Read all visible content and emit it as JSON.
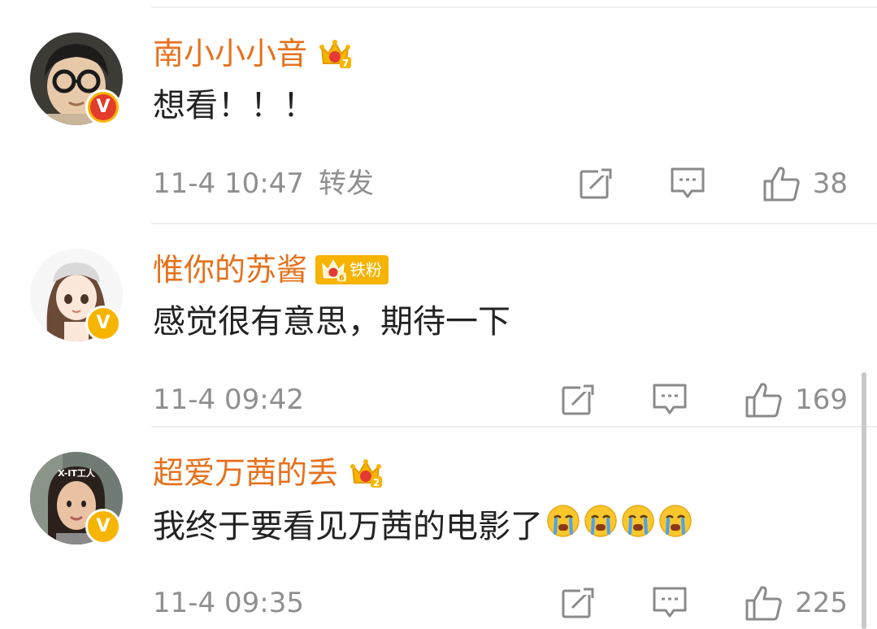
{
  "comments": [
    {
      "username": "南小小小音",
      "crown_level": "7",
      "fan_badge": "",
      "verified_color": "red",
      "verified_glyph": "V",
      "text": "想看！！！",
      "emoji_count": 0,
      "timestamp": "11-4 10:47",
      "repost_label": "转发",
      "likes": "38",
      "avatar_desc": "child-with-round-glasses"
    },
    {
      "username": "惟你的苏酱",
      "crown_level": "6",
      "fan_badge": "铁粉",
      "verified_color": "gold",
      "verified_glyph": "V",
      "text": "感觉很有意思，期待一下",
      "emoji_count": 0,
      "timestamp": "11-4 09:42",
      "repost_label": "",
      "likes": "169",
      "avatar_desc": "anime-girl-with-cap"
    },
    {
      "username": "超爱万茜的丢",
      "crown_level": "2",
      "fan_badge": "",
      "verified_color": "gold",
      "verified_glyph": "V",
      "text": "我终于要看见万茜的电影了",
      "emoji_count": 4,
      "timestamp": "11-4 09:35",
      "repost_label": "",
      "likes": "225",
      "avatar_desc": "woman-photo",
      "avatar_caption": "X-IT工人"
    }
  ],
  "colors": {
    "username": "#e6711c",
    "text": "#222222",
    "meta": "#8f8f8f",
    "icon": "#8a8a8a",
    "crown_gold": "#f6b500",
    "crown_red": "#e53935"
  },
  "icons": [
    "crown-badge-icon",
    "verified-v-icon",
    "share-icon",
    "comment-icon",
    "like-icon",
    "crying-emoji-icon"
  ]
}
